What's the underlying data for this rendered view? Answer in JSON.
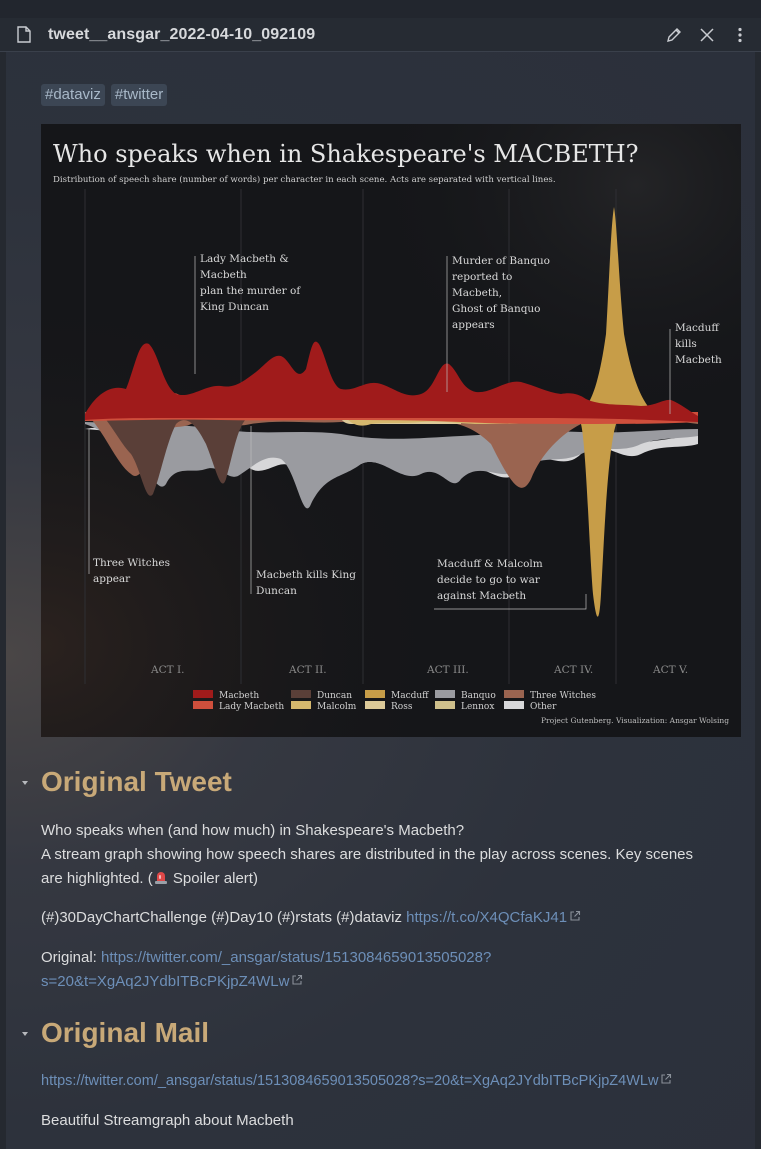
{
  "tab": {
    "title": "tweet__ansgar_2022-04-10_092109"
  },
  "tags": [
    "#dataviz",
    "#twitter"
  ],
  "chart_image": {
    "title": "Who speaks when in Shakespeare's MACBETH?",
    "subtitle": "Distribution of speech share (number of words) per character in each scene. Acts are separated with vertical lines.",
    "annotations": {
      "lady_macbeth": [
        "Lady Macbeth &",
        "Macbeth",
        "plan the murder of",
        "King Duncan"
      ],
      "banquo": [
        "Murder of Banquo",
        "reported to",
        "Macbeth,",
        "Ghost of Banquo",
        "appears"
      ],
      "macduff_kills": [
        "Macduff",
        "kills",
        "Macbeth"
      ],
      "witches": [
        "Three Witches",
        "appear"
      ],
      "macbeth_kills": [
        "Macbeth kills King",
        "Duncan"
      ],
      "war": [
        "Macduff & Malcolm",
        "decide to go to war",
        "against Macbeth"
      ]
    },
    "acts": [
      "ACT I.",
      "ACT II.",
      "ACT III.",
      "ACT IV.",
      "ACT V."
    ],
    "legend": [
      {
        "label": "Macbeth",
        "color": "#a01b1b"
      },
      {
        "label": "Lady Macbeth",
        "color": "#cf4f3c"
      },
      {
        "label": "Duncan",
        "color": "#5a3f38"
      },
      {
        "label": "Malcolm",
        "color": "#d5b86e"
      },
      {
        "label": "Macduff",
        "color": "#c79d48"
      },
      {
        "label": "Ross",
        "color": "#dcc998"
      },
      {
        "label": "Banquo",
        "color": "#9a9ba0"
      },
      {
        "label": "Lennox",
        "color": "#cfc08c"
      },
      {
        "label": "Three Witches",
        "color": "#9a6450"
      },
      {
        "label": "Other",
        "color": "#d7d7d9"
      }
    ],
    "credit": "Project Gutenberg. Visualization: Ansgar Wolsing"
  },
  "sections": {
    "tweet": {
      "heading": "Original Tweet",
      "line1": "Who speaks when (and how much) in Shakespeare's Macbeth?",
      "line2": "A stream graph showing how speech shares are distributed in the play across scenes. Key scenes",
      "line3_pre": "are highlighted. (",
      "line3_post": " Spoiler alert)",
      "hashtags": "(#)30DayChartChallenge (#)Day10 (#)rstats (#)dataviz ",
      "tco_link": "https://t.co/X4QCfaKJ41",
      "original_label": "Original: ",
      "original_link_1": "https://twitter.com/_ansgar/status/1513084659013505028?",
      "original_link_2": "s=20&t=XgAq2JYdbITBcPKjpZ4WLw"
    },
    "mail": {
      "heading": "Original Mail",
      "link": "https://twitter.com/_ansgar/status/1513084659013505028?s=20&t=XgAq2JYdbITBcPKjpZ4WLw",
      "body": "Beautiful Streamgraph about Macbeth"
    }
  }
}
